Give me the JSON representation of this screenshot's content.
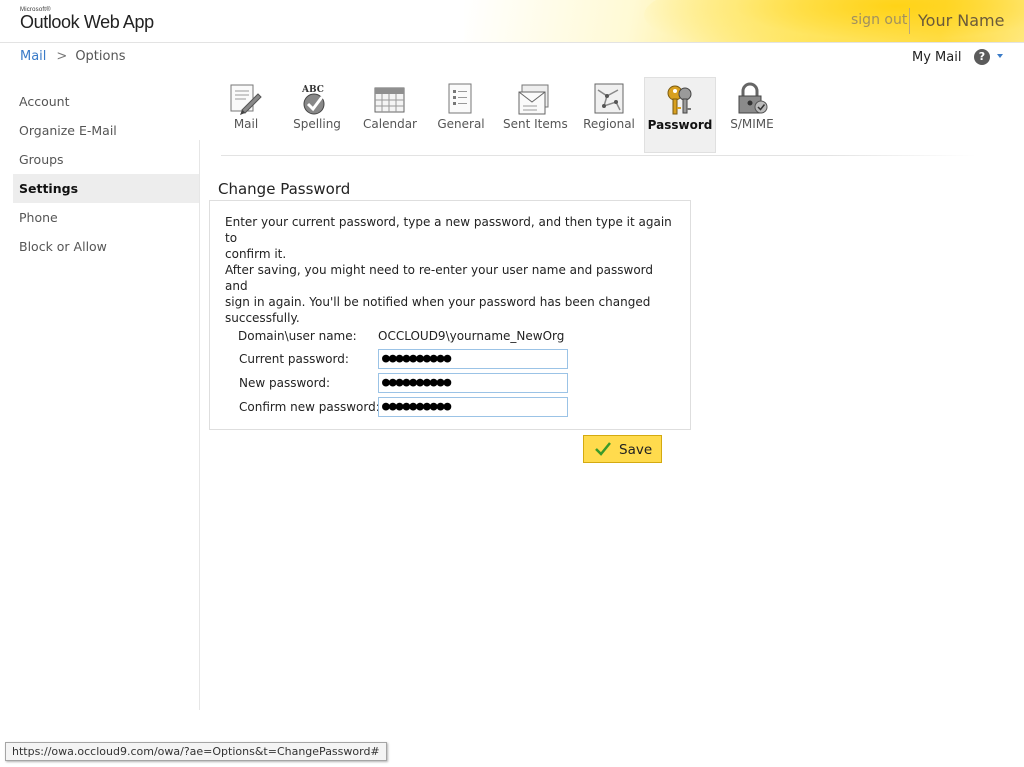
{
  "header": {
    "brand_small": "Microsoft®",
    "brand": "Outlook Web App",
    "sign_out": "sign out",
    "user_name": "Your Name"
  },
  "breadcrumb": {
    "mail": "Mail",
    "separator": ">",
    "options": "Options"
  },
  "topright": {
    "my_mail": "My Mail",
    "help": "?"
  },
  "sidebar": {
    "items": [
      {
        "label": "Account",
        "active": false
      },
      {
        "label": "Organize E-Mail",
        "active": false
      },
      {
        "label": "Groups",
        "active": false
      },
      {
        "label": "Settings",
        "active": true
      },
      {
        "label": "Phone",
        "active": false
      },
      {
        "label": "Block or Allow",
        "active": false
      }
    ]
  },
  "toolbar": {
    "items": [
      {
        "label": "Mail",
        "icon": "mail-options-icon"
      },
      {
        "label": "Spelling",
        "icon": "spelling-icon",
        "icon_text": "ABC"
      },
      {
        "label": "Calendar",
        "icon": "calendar-icon"
      },
      {
        "label": "General",
        "icon": "general-icon"
      },
      {
        "label": "Sent Items",
        "icon": "sent-items-icon"
      },
      {
        "label": "Regional",
        "icon": "regional-icon"
      },
      {
        "label": "Password",
        "icon": "password-icon",
        "active": true
      },
      {
        "label": "S/MIME",
        "icon": "smime-icon"
      }
    ]
  },
  "change_password": {
    "title": "Change Password",
    "intro_line1": "Enter your current password, type a new password, and then type it again to",
    "intro_line2": "confirm it.",
    "note_line1": "After saving, you might need to re-enter your user name and password and",
    "note_line2": "sign in again. You'll be notified when your password has been changed",
    "note_line3": "successfully.",
    "domain_label": "Domain\\user name:",
    "domain_value": "OCCLOUD9\\yourname_NewOrg",
    "current_label": "Current password:",
    "current_value": "●●●●●●●●●●",
    "new_label": "New password:",
    "new_value": "●●●●●●●●●●",
    "confirm_label": "Confirm new password:",
    "confirm_value": "●●●●●●●●●●",
    "save": "Save"
  },
  "status_bar": {
    "url": "https://owa.occloud9.com/owa/?ae=Options&t=ChangePassword#"
  },
  "colors": {
    "accent_link": "#3a7bc8",
    "save_button": "#ffdb4d",
    "input_border": "#9bc3e6"
  }
}
